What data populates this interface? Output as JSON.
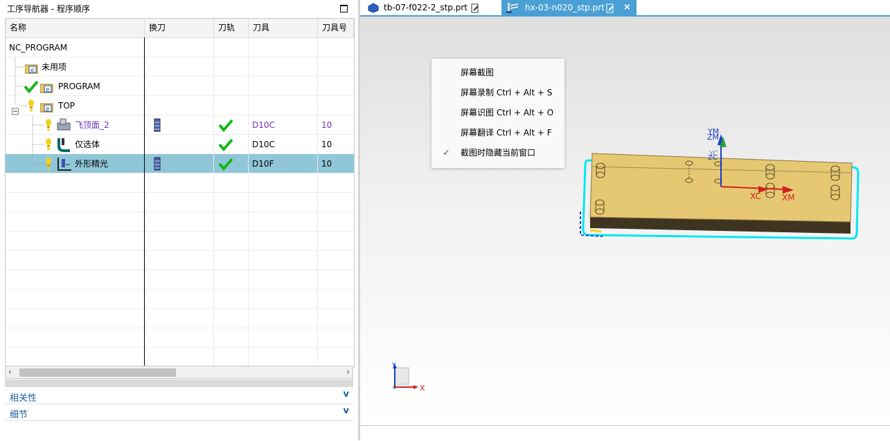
{
  "navigator": {
    "title": "工序导航器 - 程序顺序",
    "columns": [
      "名称",
      "换刀",
      "刀轨",
      "刀具",
      "刀具号"
    ],
    "rows": [
      {
        "name": "NC_PROGRAM",
        "tool": "",
        "tool_no": ""
      },
      {
        "name": "未用项",
        "tool": "",
        "tool_no": ""
      },
      {
        "name": "PROGRAM",
        "tool": "",
        "tool_no": ""
      },
      {
        "name": "TOP",
        "tool": "",
        "tool_no": ""
      },
      {
        "name": "飞顶面_2",
        "tool": "D10C",
        "tool_no": "10"
      },
      {
        "name": "仅选体",
        "tool": "D10C",
        "tool_no": "10"
      },
      {
        "name": "外形精光",
        "tool": "D10F",
        "tool_no": "10"
      }
    ],
    "sections": [
      "相关性",
      "细节"
    ]
  },
  "tabs": [
    {
      "label": "tb-07-f022-2_stp.prt",
      "active": false
    },
    {
      "label": "hx-03-n020_stp.prt",
      "active": true,
      "close": "×"
    }
  ],
  "context_menu": {
    "items": [
      {
        "label": "屏幕截图",
        "checked": false
      },
      {
        "label": "屏幕录制 Ctrl + Alt + S",
        "checked": false
      },
      {
        "label": "屏幕识图 Ctrl + Alt + O",
        "checked": false
      },
      {
        "label": "屏幕翻译 Ctrl + Alt + F",
        "checked": false
      },
      {
        "label": "截图时隐藏当前窗口",
        "checked": true
      }
    ]
  },
  "axes": {
    "ym": "YM",
    "zm": "ZM",
    "yc": "YC",
    "zc": "ZC",
    "xc": "XC",
    "xm": "XM",
    "triad_x": "X",
    "triad_y": "Y"
  },
  "colors": {
    "accent": "#4aa0d4",
    "selected_row": "#90c7d8",
    "part_top": "#e6c873",
    "part_front": "#3e3420",
    "highlight": "#00e8f0",
    "axis_red": "#d42020",
    "axis_blue": "#1a3ccc"
  }
}
